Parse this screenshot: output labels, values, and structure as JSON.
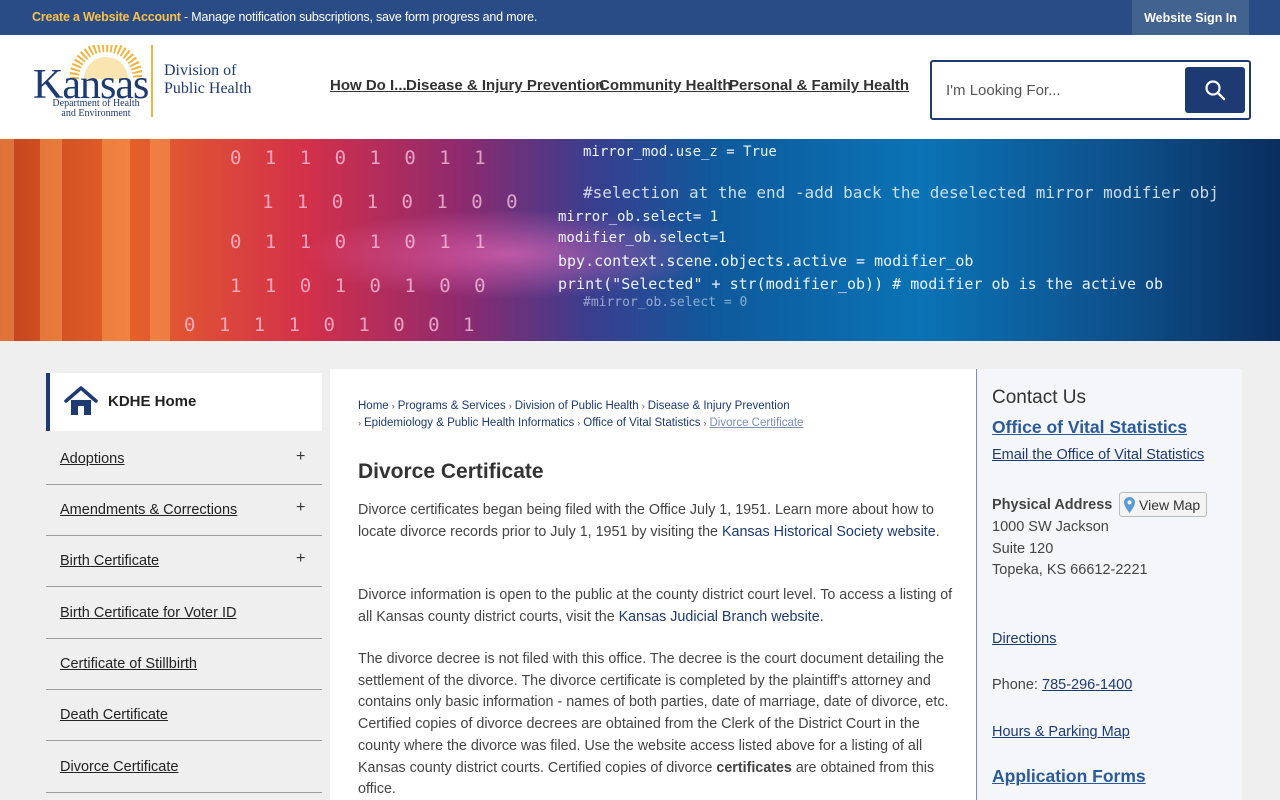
{
  "topbar": {
    "create_link": "Create a Website Account",
    "message": " - Manage notification subscriptions, save form progress and more.",
    "sign_in": "Website Sign In"
  },
  "logo": {
    "name": "Kansas",
    "dept_line1": "Department of Health",
    "dept_line2": "and Environment",
    "division_line1": "Division of",
    "division_line2": "Public Health"
  },
  "nav": {
    "items": [
      {
        "label": "How Do I..."
      },
      {
        "label": "Disease & Injury Prevention"
      },
      {
        "label": "Community Health"
      },
      {
        "label": "Personal & Family Health"
      }
    ]
  },
  "search": {
    "placeholder": "I'm Looking For...",
    "icon": "search-icon"
  },
  "banner": {
    "binary": [
      "0 1 1 0 1 0 1 1",
      "1 1 0 1 0 1 0 0",
      "0 1 1 0 1 0 1 1",
      "1 1 0 1 0 1 0 0",
      "0 1 1 1 0 1 0 0 1"
    ],
    "code": [
      "mirror_mod.use_z = True",
      "#selection at the end -add back the deselected mirror modifier obj",
      "mirror_ob.select= 1",
      "modifier_ob.select=1",
      "bpy.context.scene.objects.active = modifier_ob",
      "print(\"Selected\" + str(modifier_ob)) # modifier ob is the active ob",
      "#mirror_ob.select = 0"
    ]
  },
  "sidebar": {
    "home": "KDHE Home",
    "items": [
      {
        "label": "Adoptions",
        "expand": "+"
      },
      {
        "label": "Amendments & Corrections",
        "expand": "+"
      },
      {
        "label": "Birth Certificate",
        "expand": "+"
      },
      {
        "label": "Birth Certificate for Voter ID"
      },
      {
        "label": "Certificate of Stillbirth"
      },
      {
        "label": "Death Certificate"
      },
      {
        "label": "Divorce Certificate"
      }
    ]
  },
  "breadcrumb": {
    "items": [
      "Home",
      "Programs & Services",
      "Division of Public Health",
      "Disease & Injury Prevention",
      "Epidemiology & Public Health Informatics",
      "Office of Vital Statistics"
    ],
    "current": "Divorce Certificate"
  },
  "main": {
    "title": "Divorce Certificate",
    "p1_text": "Divorce certificates began being filed with the Office July 1, 1951. Learn more about how to locate divorce records prior to July 1, 1951 by visiting the ",
    "p1_link": "Kansas Historical Society website",
    "p1_end": ".",
    "p2_text": "Divorce information is open to the public at the county district court level. To access a listing of all Kansas county district courts, visit the ",
    "p2_link": "Kansas Judicial Branch website",
    "p2_end": ".",
    "p3_text": "The divorce decree is not filed with this office. The decree is the court document detailing the settlement of the divorce. The divorce certificate is completed by the plaintiff's attorney and contains only basic information - names of both parties, date of marriage, date of divorce, etc. Certified copies of divorce decrees are obtained from the Clerk of the District Court in the county where the divorce was filed. Use the website access listed above for a listing of all Kansas county district courts. Certified copies of divorce ",
    "p3_bold": "certificates",
    "p3_end": " are obtained from this office."
  },
  "contact": {
    "heading": "Contact Us",
    "office": "Office of Vital Statistics",
    "email": "Email the Office of Vital Statistics",
    "address_label": "Physical Address",
    "view_map": "View Map",
    "address_line1": "1000 SW Jackson",
    "address_line2": "Suite 120",
    "address_line3": "Topeka, KS 66612-2221",
    "directions": "Directions",
    "phone_label": "Phone: ",
    "phone": "785-296-1400",
    "hours": "Hours & Parking Map",
    "forms": "Application Forms"
  },
  "colors": {
    "topbar": "#2a4c86",
    "accent": "#1d3a72",
    "create_link": "#f7c04a"
  }
}
